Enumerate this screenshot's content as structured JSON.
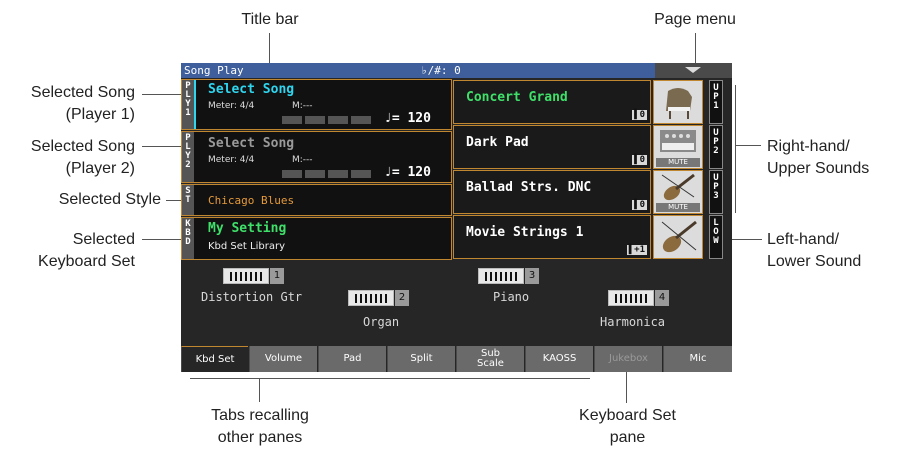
{
  "callouts": {
    "title_bar": "Title bar",
    "page_menu": "Page menu",
    "song_p1_l1": "Selected Song",
    "song_p1_l2": "(Player 1)",
    "song_p2_l1": "Selected Song",
    "song_p2_l2": "(Player 2)",
    "style": "Selected Style",
    "kbd_l1": "Selected",
    "kbd_l2": "Keyboard Set",
    "upper_l1": "Right-hand/",
    "upper_l2": "Upper Sounds",
    "lower_l1": "Left-hand/",
    "lower_l2": "Lower Sound",
    "tabs_l1": "Tabs recalling",
    "tabs_l2": "other panes",
    "pane_l1": "Keyboard Set",
    "pane_l2": "pane"
  },
  "titlebar": {
    "title": "Song Play",
    "transpose": "♭/#: 0"
  },
  "player1": {
    "tag": "PLY1",
    "song": "Select Song",
    "meter": "Meter: 4/4",
    "measure": "M:---",
    "tempo": "♩= 120"
  },
  "player2": {
    "tag": "PLY2",
    "song": "Select Song",
    "meter": "Meter: 4/4",
    "measure": "M:---",
    "tempo": "♩= 120"
  },
  "style": {
    "tag": "ST",
    "name": "Chicago Blues"
  },
  "kbd": {
    "tag": "KBD",
    "name": "My Setting",
    "library": "Kbd Set Library"
  },
  "sounds": [
    {
      "name": "Concert Grand",
      "indicator": "0",
      "tag": "UP1",
      "icon": "piano-icon",
      "mute": ""
    },
    {
      "name": "Dark Pad",
      "indicator": "0",
      "tag": "UP2",
      "icon": "synth-pad-icon",
      "mute": "MUTE"
    },
    {
      "name": "Ballad Strs. DNC",
      "indicator": "0",
      "tag": "UP3",
      "icon": "violin-icon",
      "mute": "MUTE"
    },
    {
      "name": "Movie Strings 1",
      "indicator": "+1",
      "tag": "LOW",
      "icon": "violin-icon",
      "mute": ""
    }
  ],
  "kbd_pane": [
    {
      "num": "1",
      "name": "Distortion Gtr"
    },
    {
      "num": "2",
      "name": "Organ"
    },
    {
      "num": "3",
      "name": "Piano"
    },
    {
      "num": "4",
      "name": "Harmonica"
    }
  ],
  "tabs": [
    {
      "label": "Kbd Set",
      "active": true
    },
    {
      "label": "Volume"
    },
    {
      "label": "Pad"
    },
    {
      "label": "Split"
    },
    {
      "label": "Sub Scale"
    },
    {
      "label": "KAOSS"
    },
    {
      "label": "Jukebox",
      "disabled": true
    },
    {
      "label": "Mic"
    }
  ],
  "colors": {
    "accent_orange": "#c08630",
    "song_cyan": "#2fd6f0",
    "green": "#3fe06a",
    "title_blue": "#3e5f9c"
  }
}
